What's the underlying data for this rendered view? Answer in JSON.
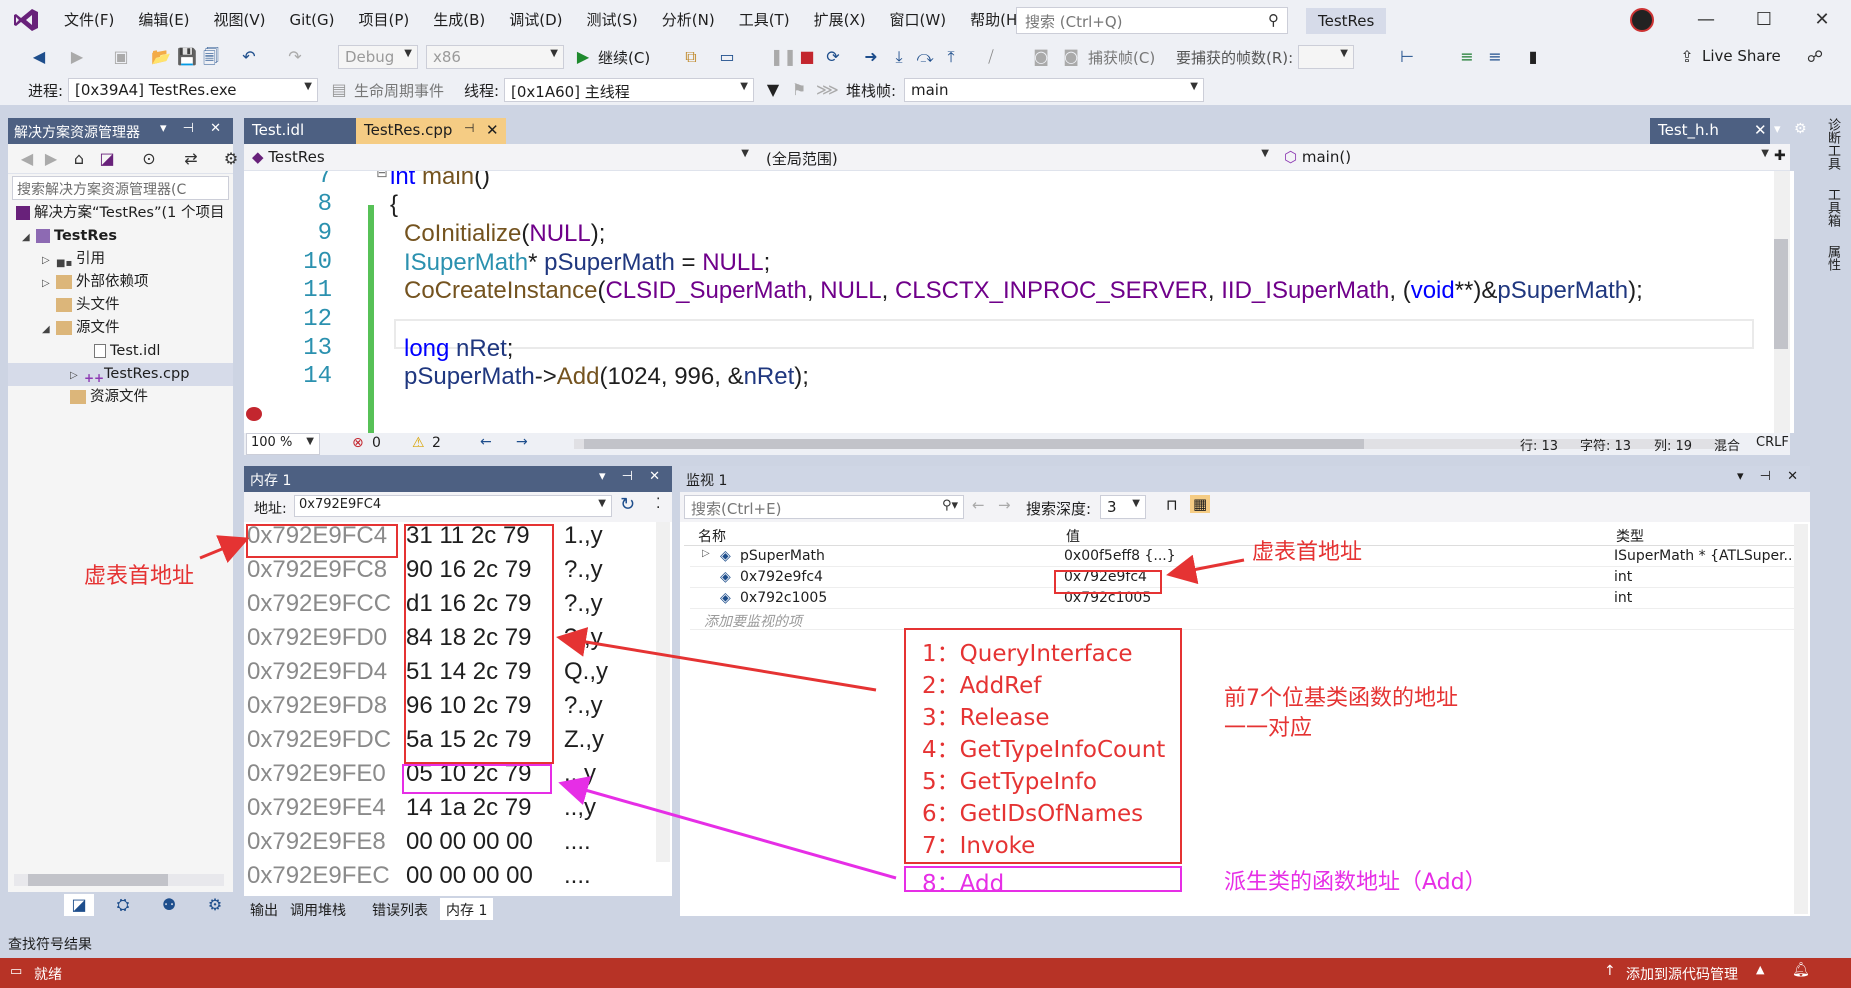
{
  "menus": [
    "文件(F)",
    "编辑(E)",
    "视图(V)",
    "Git(G)",
    "项目(P)",
    "生成(B)",
    "调试(D)",
    "测试(S)",
    "分析(N)",
    "工具(T)",
    "扩展(X)",
    "窗口(W)",
    "帮助(H)"
  ],
  "quick_search": {
    "placeholder": "搜索 (Ctrl+Q)"
  },
  "project_title": "TestRes",
  "toolbar": {
    "config": "Debug",
    "platform": "x86",
    "continue_label": "继续(C)",
    "capture_frame": "捕获帧(C)",
    "frames_label": "要捕获的帧数(R):",
    "live_share": "Live Share"
  },
  "toolbar2": {
    "process_label": "进程:",
    "process_value": "[0x39A4] TestRes.exe",
    "lifecycle": "生命周期事件",
    "thread_label": "线程:",
    "thread_value": "[0x1A60] 主线程",
    "stack_label": "堆栈帧:",
    "stack_value": "main"
  },
  "solution_explorer": {
    "title": "解决方案资源管理器",
    "search_placeholder": "搜索解决方案资源管理器(C",
    "items": [
      {
        "label": "解决方案“TestRes”(1 个项目"
      },
      {
        "label": "TestRes"
      },
      {
        "label": "引用"
      },
      {
        "label": "外部依赖项"
      },
      {
        "label": "头文件"
      },
      {
        "label": "源文件"
      },
      {
        "label": "Test.idl"
      },
      {
        "label": "TestRes.cpp"
      },
      {
        "label": "资源文件"
      }
    ]
  },
  "editor": {
    "tabs": [
      "Test.idl",
      "TestRes.cpp",
      "Test_h.h"
    ],
    "nav": {
      "project": "TestRes",
      "scope": "(全局范围)",
      "member": "main()"
    },
    "zoom": "100 %",
    "errors": "0",
    "warnings": "2",
    "status": {
      "line": "行: 13",
      "char": "字符: 13",
      "col": "列: 19",
      "mixed": "混合",
      "eol": "CRLF"
    },
    "lines": [
      {
        "num": "7",
        "text": "int main()"
      },
      {
        "num": "8",
        "text": "{"
      },
      {
        "num": "9",
        "text": "CoInitialize(NULL);"
      },
      {
        "num": "10",
        "text": "ISuperMath* pSuperMath = NULL;"
      },
      {
        "num": "11",
        "text": "CoCreateInstance(CLSID_SuperMath, NULL, CLSCTX_INPROC_SERVER, IID_ISuperMath, (void**)&pSuperMath);"
      },
      {
        "num": "12",
        "text": ""
      },
      {
        "num": "13",
        "text": "long nRet;"
      },
      {
        "num": "14",
        "text": "pSuperMath->Add(1024, 996, &nRet);"
      }
    ]
  },
  "memory": {
    "title": "内存 1",
    "addr_label": "地址:",
    "addr_value": "0x792E9FC4",
    "rows": [
      {
        "addr": "0x792E9FC4",
        "bytes": "31 11 2c 79",
        "ascii": "1.,y"
      },
      {
        "addr": "0x792E9FC8",
        "bytes": "90 16 2c 79",
        "ascii": "?.,y"
      },
      {
        "addr": "0x792E9FCC",
        "bytes": "d1 16 2c 79",
        "ascii": "?.,y"
      },
      {
        "addr": "0x792E9FD0",
        "bytes": "84 18 2c 79",
        "ascii": "?.,y"
      },
      {
        "addr": "0x792E9FD4",
        "bytes": "51 14 2c 79",
        "ascii": "Q.,y"
      },
      {
        "addr": "0x792E9FD8",
        "bytes": "96 10 2c 79",
        "ascii": "?.,y"
      },
      {
        "addr": "0x792E9FDC",
        "bytes": "5a 15 2c 79",
        "ascii": "Z.,y"
      },
      {
        "addr": "0x792E9FE0",
        "bytes": "05 10 2c 79",
        "ascii": "..,y"
      },
      {
        "addr": "0x792E9FE4",
        "bytes": "14 1a 2c 79",
        "ascii": "..,y"
      },
      {
        "addr": "0x792E9FE8",
        "bytes": "00 00 00 00",
        "ascii": "...."
      },
      {
        "addr": "0x792E9FEC",
        "bytes": "00 00 00 00",
        "ascii": "...."
      }
    ]
  },
  "watch": {
    "title": "监视 1",
    "search_placeholder": "搜索(Ctrl+E)",
    "depth_label": "搜索深度:",
    "depth_value": "3",
    "headers": {
      "name": "名称",
      "value": "值",
      "type": "类型"
    },
    "rows": [
      {
        "name": "pSuperMath",
        "value": "0x00f5eff8 {...}",
        "type": "ISuperMath * {ATLSuper..."
      },
      {
        "name": "0x792e9fc4",
        "value": "0x792e9fc4",
        "type": "int"
      },
      {
        "name": "0x792c1005",
        "value": "0x792c1005",
        "type": "int"
      }
    ],
    "add_placeholder": "添加要监视的项"
  },
  "bottom_tabs": [
    "输出",
    "调用堆栈",
    "错误列表",
    "内存 1"
  ],
  "side_tabs": [
    "诊断工具",
    "工具箱",
    "属性"
  ],
  "find_bar": "查找符号结果",
  "statusbar": {
    "ready": "就绪",
    "source_control": "添加到源代码管理"
  },
  "annotations": {
    "vtable_left": "虚表首地址",
    "vtable_right": "虚表首地址",
    "base_funcs": [
      "1：QueryInterface",
      "2：AddRef",
      "3：Release",
      "4：GetTypeInfoCount",
      "5：GetTypeInfo",
      "6：GetIDsOfNames",
      "7：Invoke"
    ],
    "derived_func": "8：Add",
    "note_base_line1": "前7个位基类函数的地址",
    "note_base_line2": "一一对应",
    "note_derived": "派生类的函数地址（Add）"
  },
  "colors": {
    "accent": "#4d6082",
    "statusbar": "#b73326",
    "annotation_red": "#e53333",
    "annotation_magenta": "#e62ee6"
  }
}
